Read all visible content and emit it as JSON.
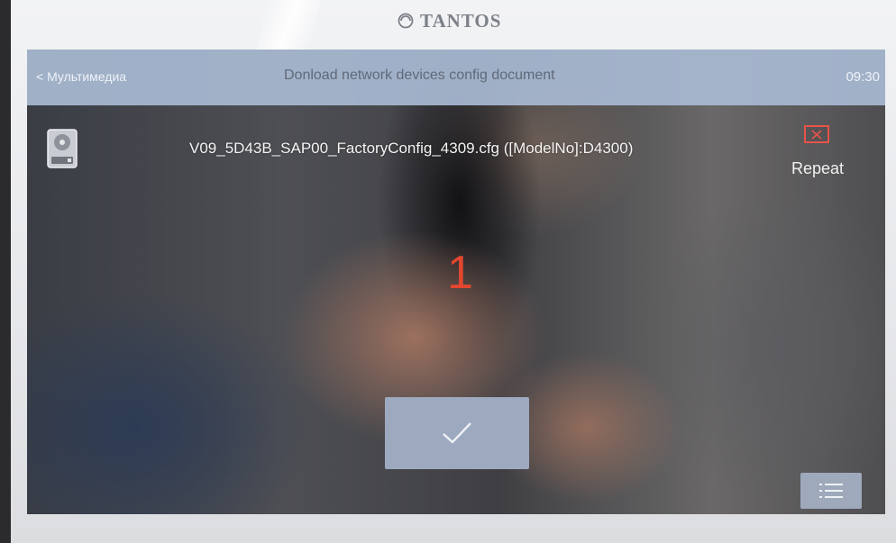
{
  "device": {
    "brand": "TANTOS",
    "brand_color": "#7c8088"
  },
  "header": {
    "back_label": "< Мультимедиа",
    "title": "Donload network devices config document",
    "time": "09:30",
    "bar_color": "#a8bad2"
  },
  "file": {
    "icon": "hard-drive-icon",
    "name": "V09_5D43B_SAP00_FactoryConfig_4309.cfg ([ModelNo]:D4300)"
  },
  "repeat": {
    "icon": "close-icon",
    "label": "Repeat",
    "accent": "#e8534a"
  },
  "counter": {
    "value": "1",
    "color": "#e3472f"
  },
  "confirm_button": {
    "icon": "checkmark-icon"
  },
  "menu_button": {
    "icon": "list-menu-icon"
  }
}
